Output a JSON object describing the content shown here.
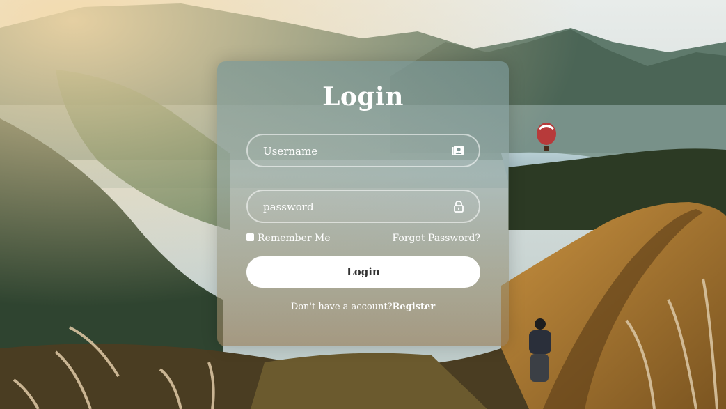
{
  "form": {
    "title": "Login",
    "username_placeholder": "Username",
    "password_placeholder": "password",
    "remember_label": "Remember Me",
    "forgot_label": "Forgot Password?",
    "login_button_label": "Login",
    "register_prompt": "Don't have a account?",
    "register_link": "Register"
  },
  "icons": {
    "username": "contact-card-icon",
    "password": "lock-icon"
  },
  "colors": {
    "text": "#ffffff",
    "button_bg": "#ffffff",
    "button_text": "#333333"
  }
}
